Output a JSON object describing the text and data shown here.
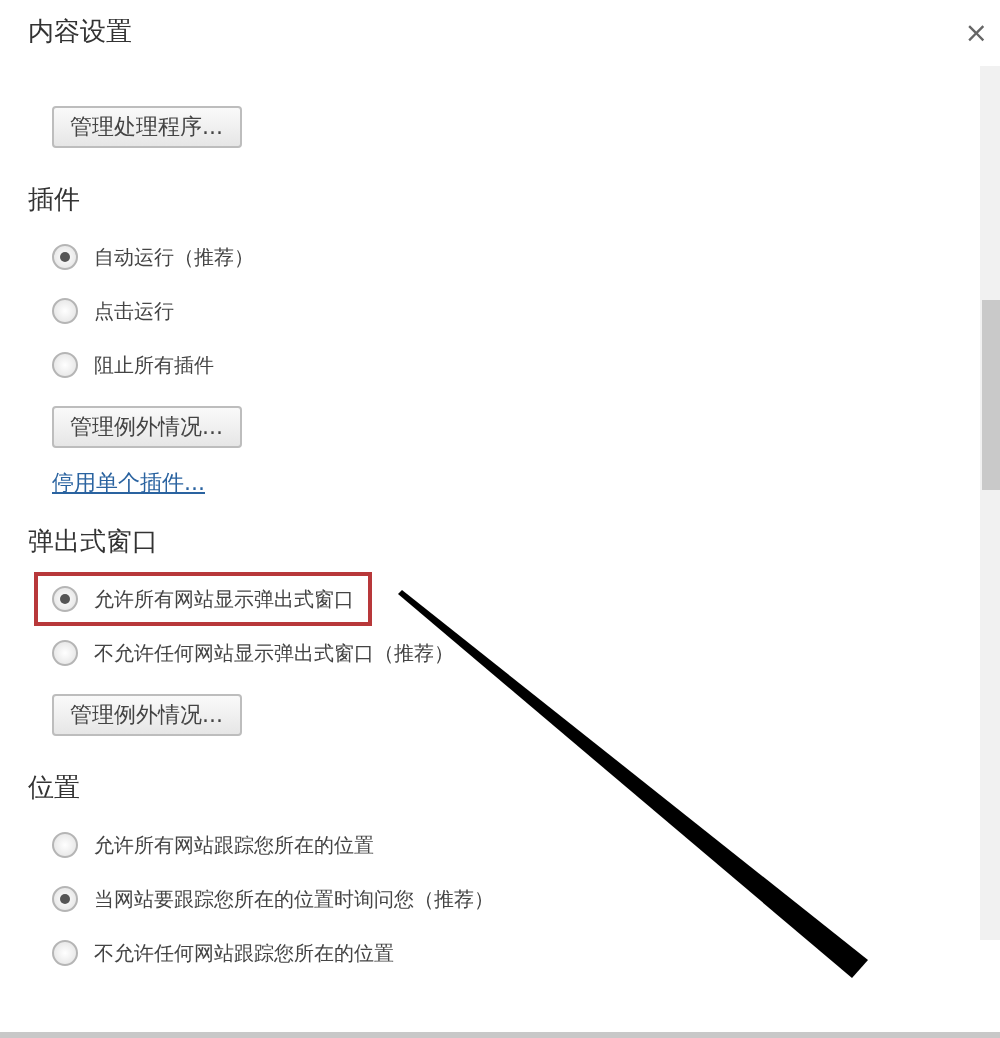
{
  "window": {
    "title": "内容设置",
    "close": "×"
  },
  "sections": [
    {
      "items": [
        {
          "kind": "button",
          "label": "管理处理程序..."
        }
      ]
    },
    {
      "heading": "插件",
      "items": [
        {
          "kind": "radio",
          "label": "自动运行（推荐）",
          "selected": true
        },
        {
          "kind": "radio",
          "label": "点击运行",
          "selected": false
        },
        {
          "kind": "radio",
          "label": "阻止所有插件",
          "selected": false
        },
        {
          "kind": "button",
          "label": "管理例外情况..."
        },
        {
          "kind": "link",
          "label": "停用单个插件..."
        }
      ]
    },
    {
      "heading": "弹出式窗口",
      "items": [
        {
          "kind": "radio",
          "label": "允许所有网站显示弹出式窗口",
          "selected": true,
          "highlighted": true
        },
        {
          "kind": "radio",
          "label": "不允许任何网站显示弹出式窗口（推荐）",
          "selected": false
        },
        {
          "kind": "button",
          "label": "管理例外情况..."
        }
      ]
    },
    {
      "heading": "位置",
      "items": [
        {
          "kind": "radio",
          "label": "允许所有网站跟踪您所在的位置",
          "selected": false
        },
        {
          "kind": "radio",
          "label": "当网站要跟踪您所在的位置时询问您（推荐）",
          "selected": true
        },
        {
          "kind": "radio",
          "label": "不允许任何网站跟踪您所在的位置",
          "selected": false
        }
      ]
    }
  ]
}
